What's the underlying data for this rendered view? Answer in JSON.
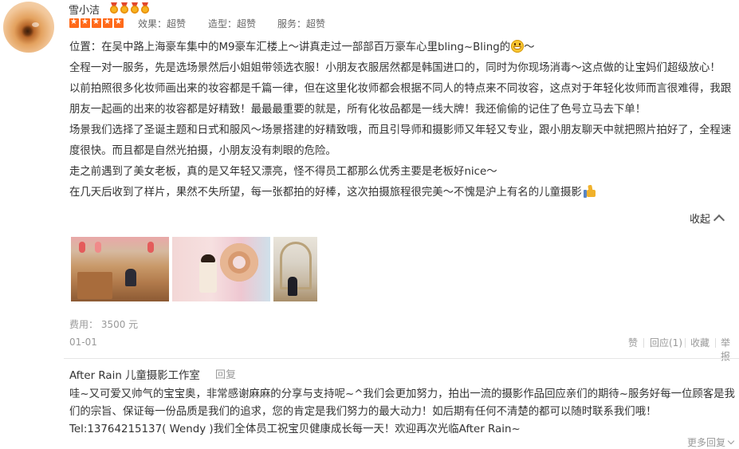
{
  "review": {
    "username": "雪小洁",
    "medal_count": 4,
    "rating_stars": 5,
    "scores": [
      {
        "label": "效果：超赞"
      },
      {
        "label": "造型：超赞"
      },
      {
        "label": "服务：超赞"
      }
    ],
    "paragraphs": [
      "位置：在吴中路上海豪车集中的M9豪车汇楼上～讲真走过一部部百万豪车心里bling~Bling的",
      "全程一对一服务，先是选场景然后小姐姐带领选衣服！小朋友衣服居然都是韩国进口的，同时为你现场消毒～这点做的让宝妈们超级放心！",
      "以前拍照很多化妆师画出来的妆容都是千篇一律，但在这里化妆师都会根据不同人的特点来不同妆容，这点对于年轻化妆师而言很难得，我跟朋友一起画的出来的妆容都是好精致！最最最重要的就是，所有化妆品都是一线大牌！我还偷偷的记住了色号立马去下单！",
      "场景我们选择了圣诞主题和日式和服风～场景搭建的好精致哦，而且引导师和摄影师又年轻又专业，跟小朋友聊天中就把照片拍好了，全程速度很快。而且都是自然光拍摄，小朋友没有刺眼的危险。",
      "走之前遇到了美女老板，真的是又年轻又漂亮，怪不得员工都那么优秀主要是老板好nice～",
      "在几天后收到了样片，果然不失所望，每一张都拍的好棒，这次拍摄旅程很完美～不愧是沪上有名的儿童摄影"
    ],
    "first_para_suffix": "～",
    "collapse_label": "收起",
    "fee": "费用：  3500 元",
    "date": "01-01",
    "actions": {
      "like": "赞",
      "reply": "回应(1)",
      "favorite": "收藏",
      "report": "举报"
    }
  },
  "merchant_reply": {
    "shop_name": "After Rain 儿童摄影工作室",
    "reply_label": "回复",
    "text": "哇~又可爱又帅气的宝宝奥，非常感谢麻麻的分享与支持呢~^我们会更加努力，拍出一流的摄影作品回应亲们的期待~服务好每一位顾客是我们的宗旨、保证每一份品质是我们的追求，您的肯定是我们努力的最大动力！如后期有任何不清楚的都可以随时联系我们哦！Tel:13764215137( Wendy )我们全体员工祝宝贝健康成长每一天！欢迎再次光临After Rain~",
    "more_label": "更多回复"
  },
  "icons": {
    "medal": "medal-icon",
    "star": "star-icon",
    "emoji": "grin-face-icon",
    "thumbs_up": "thumbs-up-icon",
    "chevron_up": "chevron-up-icon",
    "chevron_down": "chevron-down-icon"
  },
  "colors": {
    "star": "#ff6a1a",
    "muted": "#999999",
    "text": "#333333"
  }
}
